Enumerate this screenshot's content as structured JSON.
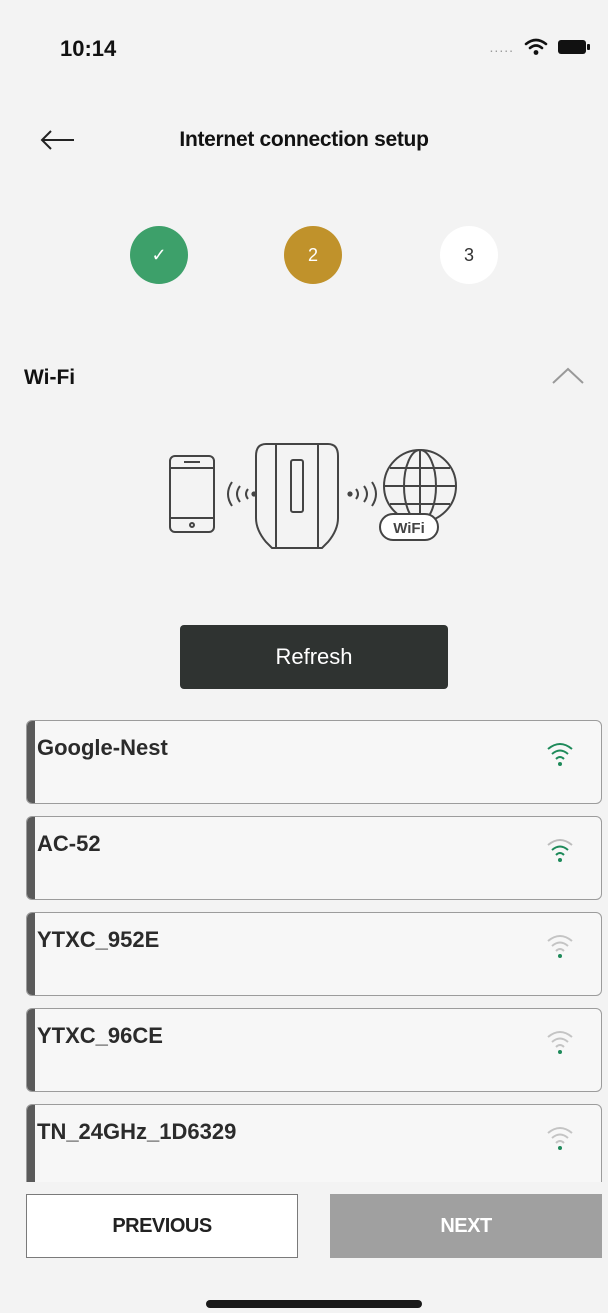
{
  "status_bar": {
    "time": "10:14",
    "signal": "....."
  },
  "header": {
    "title": "Internet connection setup"
  },
  "steps": [
    {
      "label": "✓",
      "state": "done",
      "color": "#3da06a"
    },
    {
      "label": "2",
      "state": "current",
      "color": "#c0922b"
    },
    {
      "label": "3",
      "state": "pending",
      "color": "#ffffff"
    }
  ],
  "section": {
    "title": "Wi-Fi",
    "expanded": true
  },
  "illustration": {
    "badge_text": "WiFi"
  },
  "refresh_label": "Refresh",
  "networks": [
    {
      "ssid": "Google-Nest",
      "signal": "strong"
    },
    {
      "ssid": "AC-52",
      "signal": "strong"
    },
    {
      "ssid": "YTXC_952E",
      "signal": "weak"
    },
    {
      "ssid": "YTXC_96CE",
      "signal": "weak"
    },
    {
      "ssid": "TN_24GHz_1D6329",
      "signal": "weak"
    }
  ],
  "footer": {
    "previous_label": "PREVIOUS",
    "next_label": "NEXT"
  },
  "colors": {
    "accent_green": "#1e8a5a",
    "step_done": "#3da06a",
    "step_current": "#c0922b",
    "button_dark": "#2f3331",
    "next_disabled": "#a0a0a0"
  }
}
